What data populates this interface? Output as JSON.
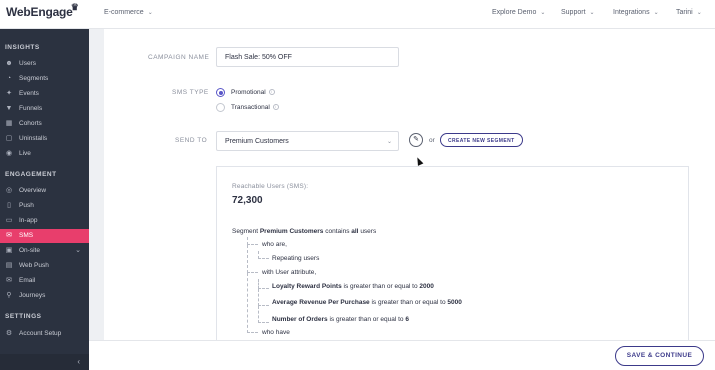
{
  "brand": {
    "logo": "WebEngage"
  },
  "topbar": {
    "project": "E-commerce",
    "links": [
      "Explore Demo",
      "Support",
      "Integrations",
      "Tarini"
    ]
  },
  "sidebar": {
    "sections": [
      {
        "title": "INSIGHTS",
        "items": [
          {
            "label": "Users",
            "icon": "users-icon"
          },
          {
            "label": "Segments",
            "icon": "segments-icon"
          },
          {
            "label": "Events",
            "icon": "events-icon"
          },
          {
            "label": "Funnels",
            "icon": "funnel-icon"
          },
          {
            "label": "Cohorts",
            "icon": "cohorts-icon"
          },
          {
            "label": "Uninstalls",
            "icon": "uninstalls-icon"
          },
          {
            "label": "Live",
            "icon": "live-icon"
          }
        ]
      },
      {
        "title": "ENGAGEMENT",
        "items": [
          {
            "label": "Overview",
            "icon": "eye-icon"
          },
          {
            "label": "Push",
            "icon": "push-icon"
          },
          {
            "label": "In-app",
            "icon": "in-app-icon"
          },
          {
            "label": "SMS",
            "icon": "sms-icon",
            "active": true
          },
          {
            "label": "On-site",
            "icon": "on-site-icon"
          },
          {
            "label": "Web Push",
            "icon": "web-push-icon"
          },
          {
            "label": "Email",
            "icon": "email-icon"
          },
          {
            "label": "Journeys",
            "icon": "journeys-icon"
          }
        ]
      },
      {
        "title": "SETTINGS",
        "items": [
          {
            "label": "Account Setup",
            "icon": "account-icon"
          }
        ]
      }
    ],
    "accent": "#e83e6c"
  },
  "form": {
    "campaign_name": {
      "label": "CAMPAIGN NAME",
      "value": "Flash Sale: 50% OFF"
    },
    "sms_type": {
      "label": "SMS TYPE",
      "options": [
        {
          "label": "Promotional",
          "selected": true
        },
        {
          "label": "Transactional",
          "selected": false
        }
      ]
    },
    "send_to": {
      "label": "SEND TO",
      "value": "Premium Customers",
      "or": "or",
      "new_segment": "CREATE NEW SEGMENT"
    }
  },
  "segment_panel": {
    "reach_label": "Reachable Users (SMS):",
    "reach_value": "72,300",
    "header": {
      "prefix": "Segment",
      "name": "Premium Customers",
      "mid": "contains",
      "quant": "all",
      "suffix": "users"
    },
    "who_are": "who are,",
    "repeating": "Repeating users",
    "with_attr": "with User attribute,",
    "conditions": [
      {
        "attr": "Loyalty Reward Points",
        "op": "is greater than or equal to",
        "val": "2000"
      },
      {
        "attr": "Average Revenue Per Purchase",
        "op": "is greater than or equal to",
        "val": "5000"
      },
      {
        "attr": "Number of Orders",
        "op": "is greater than or equal to",
        "val": "6"
      }
    ],
    "who_have": "who have"
  },
  "footer": {
    "save_label": "SAVE & CONTINUE"
  },
  "colors": {
    "sidebar_bg": "#2b3240",
    "primary": "#3c3a8a",
    "radio": "#5a57c8"
  }
}
